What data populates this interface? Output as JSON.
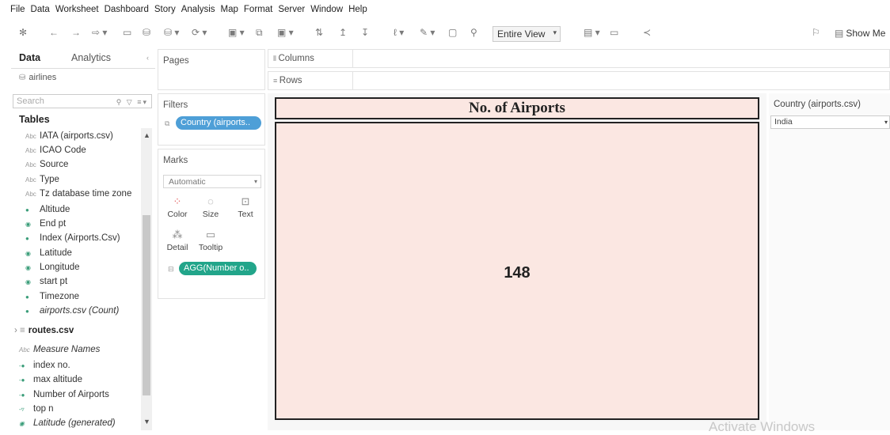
{
  "menu": [
    "File",
    "Data",
    "Worksheet",
    "Dashboard",
    "Story",
    "Analysis",
    "Map",
    "Format",
    "Server",
    "Window",
    "Help"
  ],
  "toolbar": {
    "fit_mode": "Entire View",
    "show_me": "Show Me"
  },
  "data_pane": {
    "tab_data": "Data",
    "tab_analytics": "Analytics",
    "datasource": "airlines",
    "search_placeholder": "Search",
    "tables_header": "Tables",
    "fields": [
      {
        "label": "IATA (airports.csv)",
        "icon": "Abc"
      },
      {
        "label": "ICAO Code",
        "icon": "Abc"
      },
      {
        "label": "Source",
        "icon": "Abc"
      },
      {
        "label": "Type",
        "icon": "Abc"
      },
      {
        "label": "Tz database time zone",
        "icon": "Abc"
      },
      {
        "label": "Altitude",
        "icon": "#"
      },
      {
        "label": "End pt",
        "icon": "geo"
      },
      {
        "label": "Index (Airports.Csv)",
        "icon": "#"
      },
      {
        "label": "Latitude",
        "icon": "geo"
      },
      {
        "label": "Longitude",
        "icon": "geo"
      },
      {
        "label": "start pt",
        "icon": "geo"
      },
      {
        "label": "Timezone",
        "icon": "#"
      },
      {
        "label": "airports.csv (Count)",
        "icon": "#"
      }
    ],
    "routes_table": "routes.csv",
    "measure_fields": [
      {
        "label": "Measure Names",
        "icon": "Abc"
      },
      {
        "label": "index no.",
        "icon": "#"
      },
      {
        "label": "max altitude",
        "icon": "#"
      },
      {
        "label": "Number of Airports",
        "icon": "#"
      },
      {
        "label": "top n",
        "icon": "#"
      },
      {
        "label": "Latitude (generated)",
        "icon": "geo"
      }
    ]
  },
  "shelves": {
    "pages": "Pages",
    "columns": "Columns",
    "rows": "Rows",
    "filters": "Filters",
    "filter_pill": "Country (airports..",
    "marks": "Marks",
    "mark_type": "Automatic",
    "mark_buttons": [
      "Color",
      "Size",
      "Text",
      "Detail",
      "Tooltip"
    ],
    "marks_pill": "AGG(Number o.."
  },
  "viz": {
    "title": "No. of Airports",
    "value": "148"
  },
  "filter_card": {
    "title": "Country (airports.csv)",
    "selected": "India"
  },
  "watermark": "Activate Windows"
}
